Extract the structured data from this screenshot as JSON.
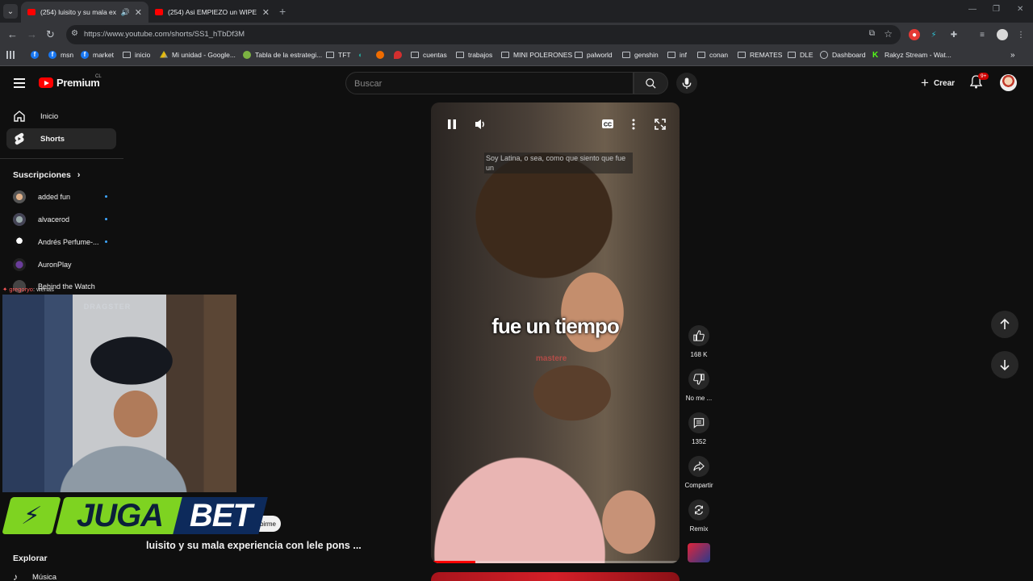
{
  "browser": {
    "tabs": [
      {
        "title": "(254) luisito y su mala expe"
      },
      {
        "title": "(254) Asi EMPIEZO un WIPE SO"
      }
    ],
    "url": "https://www.youtube.com/shorts/SS1_hTbDf3M",
    "bookmarks": [
      "msn",
      "market",
      "inicio",
      "Mi unidad - Google...",
      "Tabla de la estrategi...",
      "TFT",
      "cuentas",
      "trabajos",
      "MINI POLERONES",
      "palworld",
      "genshin",
      "inf",
      "conan",
      "REMATES",
      "DLE",
      "Dashboard",
      "Rakyz Stream - Wat..."
    ]
  },
  "header": {
    "logo_text": "Premium",
    "country": "CL",
    "search_placeholder": "Buscar",
    "create_label": "Crear",
    "notif_badge": "9+"
  },
  "sidebar": {
    "items": [
      {
        "label": "Inicio"
      },
      {
        "label": "Shorts"
      }
    ],
    "subs_heading": "Suscripciones",
    "subscriptions": [
      {
        "name": "added fun"
      },
      {
        "name": "alvacerod"
      },
      {
        "name": "Andrés Perfume-..."
      },
      {
        "name": "AuronPlay"
      },
      {
        "name": "Behind the Watch"
      }
    ],
    "explore_heading": "Explorar",
    "music_label": "Música"
  },
  "overlay": {
    "chat_user": "gregoryo",
    "chat_msg": ": wenas",
    "chair_brand": "DRAGSTER",
    "sponsor_left": "JUGA",
    "sponsor_right": "BET",
    "sub_button": "birme"
  },
  "short": {
    "title": "luisito y su mala experiencia con lele pons ...",
    "caption_top": "Soy Latina, o sea, como que siento que fue un",
    "caption_main": "fue un tiempo",
    "watermark": "mastere",
    "progress": 0.18
  },
  "actions": {
    "likes": "168 K",
    "dislike": "No me ...",
    "comments": "1352",
    "share": "Compartir",
    "remix": "Remix"
  }
}
